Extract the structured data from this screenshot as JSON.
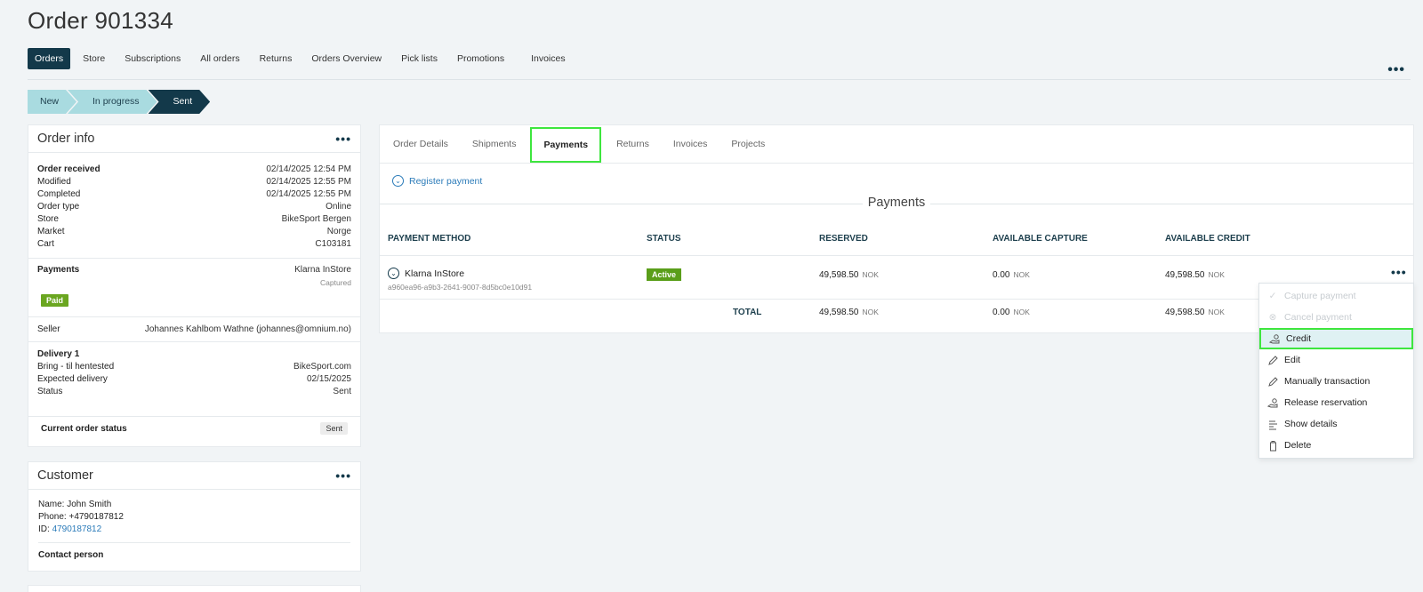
{
  "page": {
    "title": "Order 901334"
  },
  "nav": {
    "items": [
      "Orders",
      "Store",
      "Subscriptions",
      "All orders",
      "Returns",
      "Orders Overview",
      "Pick lists",
      "Promotions",
      "Invoices"
    ],
    "active": "Orders",
    "more": "•••"
  },
  "steps": [
    "New",
    "In progress",
    "Sent"
  ],
  "order_info": {
    "title": "Order info",
    "more": "•••",
    "rows": [
      {
        "key": "Order received",
        "value": "02/14/2025 12:54 PM"
      },
      {
        "key": "Modified",
        "value": "02/14/2025 12:55 PM"
      },
      {
        "key": "Completed",
        "value": "02/14/2025 12:55 PM"
      },
      {
        "key": "Order type",
        "value": "Online"
      },
      {
        "key": "Store",
        "value": "BikeSport Bergen"
      },
      {
        "key": "Market",
        "value": "Norge"
      },
      {
        "key": "Cart",
        "value": "C103181"
      }
    ],
    "payments_label": "Payments",
    "payments_value": "Klarna InStore",
    "payments_sub": "Captured",
    "paid_badge": "Paid",
    "seller_label": "Seller",
    "seller_value": "Johannes Kahlbom Wathne (johannes@omnium.no)",
    "delivery_title": "Delivery 1",
    "delivery_rows": [
      {
        "key": "Bring - til hentested",
        "value": "BikeSport.com"
      },
      {
        "key": "Expected delivery",
        "value": "02/15/2025"
      },
      {
        "key": "Status",
        "value": "Sent"
      }
    ],
    "current_status_label": "Current order status",
    "current_status_value": "Sent"
  },
  "customer": {
    "title": "Customer",
    "more": "•••",
    "name": "Name: John Smith",
    "phone": "Phone: +4790187812",
    "id_label": "ID:",
    "id_value": "4790187812",
    "contact": "Contact person"
  },
  "tabs": [
    "Order Details",
    "Shipments",
    "Payments",
    "Returns",
    "Invoices",
    "Projects"
  ],
  "active_tab": "Payments",
  "register_payment": "Register payment",
  "payments_section": {
    "title": "Payments",
    "headers": {
      "method": "PAYMENT METHOD",
      "status": "STATUS",
      "reserved": "RESERVED",
      "capture": "AVAILABLE CAPTURE",
      "credit": "AVAILABLE CREDIT"
    },
    "row": {
      "method": "Klarna InStore",
      "id": "a960ea96-a9b3-2641-9007-8d5bc0e10d91",
      "status": "Active",
      "reserved": "49,598.50",
      "capture": "0.00",
      "credit": "49,598.50",
      "currency": "NOK",
      "more": "•••"
    },
    "total": {
      "label": "TOTAL",
      "reserved": "49,598.50",
      "capture": "0.00",
      "credit": "49,598.50",
      "currency": "NOK"
    }
  },
  "context_menu": [
    {
      "label": "Capture payment",
      "icon": "check-icon",
      "disabled": true
    },
    {
      "label": "Cancel payment",
      "icon": "cancel-circle-icon",
      "disabled": true
    },
    {
      "label": "Credit",
      "icon": "hand-money-icon",
      "highlighted": true
    },
    {
      "label": "Edit",
      "icon": "pencil-icon"
    },
    {
      "label": "Manually transaction",
      "icon": "pencil-icon"
    },
    {
      "label": "Release reservation",
      "icon": "hand-money-icon"
    },
    {
      "label": "Show details",
      "icon": "list-details-icon"
    },
    {
      "label": "Delete",
      "icon": "trash-icon"
    }
  ]
}
